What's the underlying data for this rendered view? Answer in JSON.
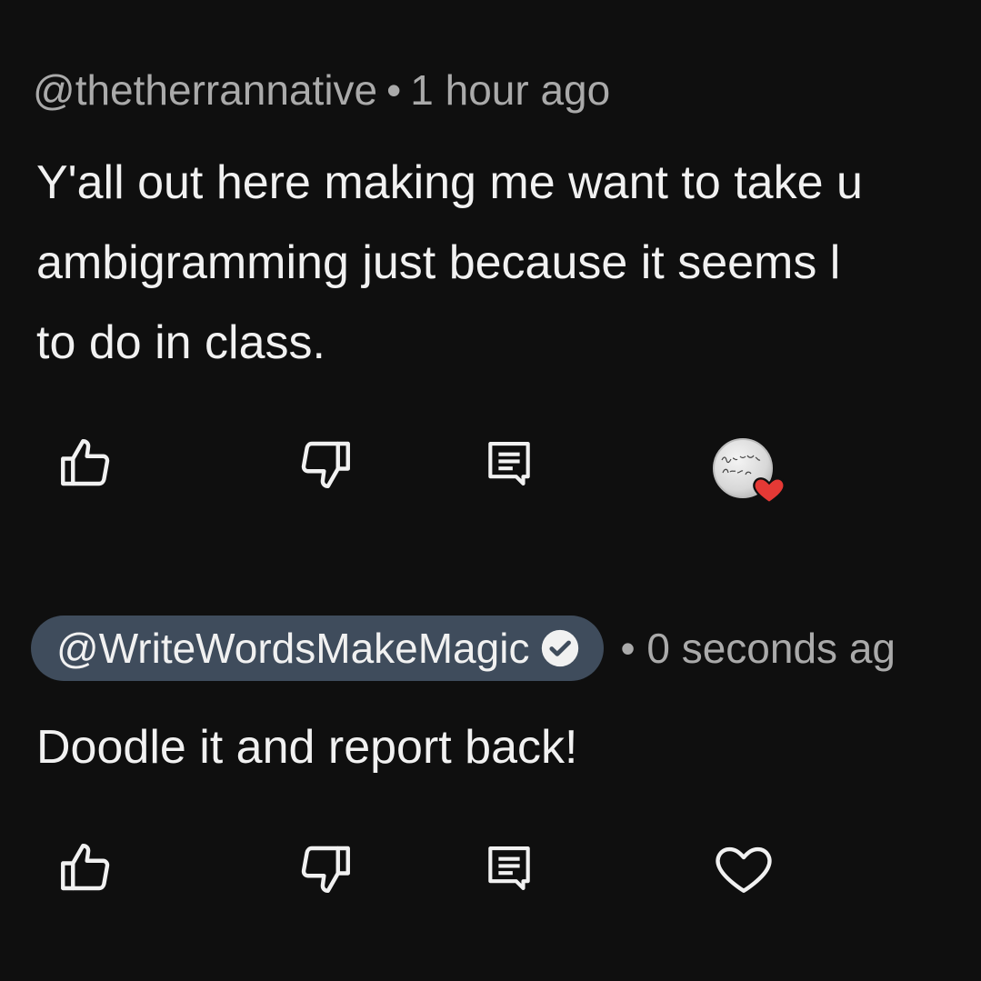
{
  "comments": [
    {
      "author": "@thetherrannative",
      "separator": "•",
      "time": "1 hour ago",
      "text_lines": [
        "Y'all out here making me want to take u",
        "ambigramming just because it seems l",
        "to do in class."
      ],
      "creator_hearted": true
    },
    {
      "author": "@WriteWordsMakeMagic",
      "author_verified": true,
      "separator": "•",
      "time": "0 seconds ag",
      "text_lines": [
        "Doodle it and report back!"
      ],
      "creator_hearted": false
    }
  ],
  "icons": {
    "like": "thumbs-up-icon",
    "dislike": "thumbs-down-icon",
    "reply": "reply-icon",
    "heart": "heart-icon",
    "verified": "verified-check-icon"
  },
  "colors": {
    "background": "#0f0f0f",
    "primary_text": "#f1f1f1",
    "secondary_text": "#aaaaaa",
    "author_pill": "#3f4c5c",
    "heart_red": "#e53935"
  }
}
